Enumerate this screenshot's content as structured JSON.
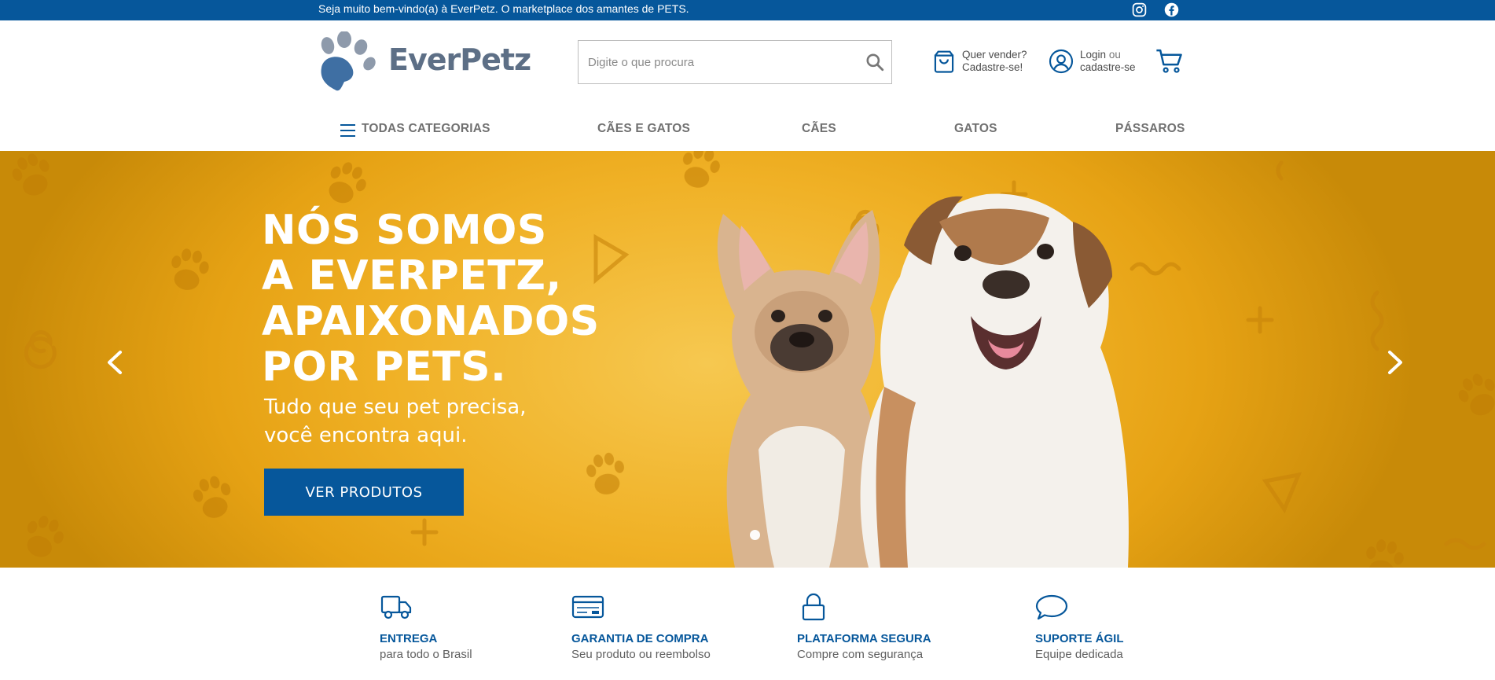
{
  "topbar": {
    "welcome": "Seja muito bem-vindo(a) à EverPetz. O marketplace dos amantes de PETS."
  },
  "header": {
    "logo_text": "EverPetz",
    "search_placeholder": "Digite o que procura",
    "sell_line1": "Quer vender?",
    "sell_line2": "Cadastre-se!",
    "login_label": "Login",
    "login_or": "ou",
    "login_line2": "cadastre-se"
  },
  "nav": {
    "all_categories": "TODAS CATEGORIAS",
    "items": [
      "CÃES E GATOS",
      "CÃES",
      "GATOS",
      "PÁSSAROS"
    ]
  },
  "hero": {
    "title_lines": [
      "NÓS SOMOS",
      "A EVERPETZ,",
      "APAIXONADOS",
      "POR PETS."
    ],
    "subtitle_lines": [
      "Tudo que seu pet precisa,",
      "você encontra aqui."
    ],
    "cta": "VER PRODUTOS"
  },
  "features": [
    {
      "icon": "truck-icon",
      "title": "ENTREGA",
      "desc": "para todo o Brasil"
    },
    {
      "icon": "credit-card-icon",
      "title": "GARANTIA DE COMPRA",
      "desc": "Seu produto ou reembolso"
    },
    {
      "icon": "lock-icon",
      "title": "PLATAFORMA SEGURA",
      "desc": "Compre com segurança"
    },
    {
      "icon": "chat-bubble-icon",
      "title": "SUPORTE ÁGIL",
      "desc": "Equipe dedicada"
    }
  ],
  "colors": {
    "brand_blue": "#06579b",
    "hero_yellow": "#f0b126",
    "logo_gray": "#5d6f86"
  }
}
